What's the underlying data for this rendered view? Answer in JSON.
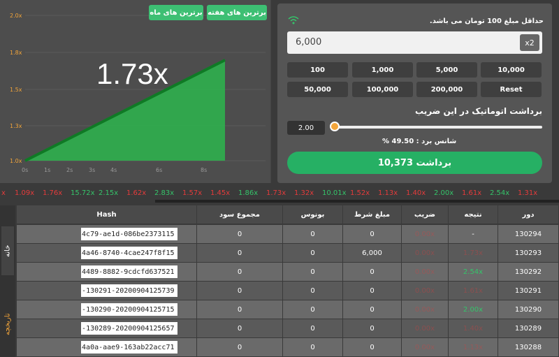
{
  "chart": {
    "multiplier": "1.73x",
    "y_ticks": [
      "2.0x",
      "1.8x",
      "1.5x",
      "1.3x",
      "1.0x"
    ],
    "x_ticks": [
      "0s",
      "1s",
      "2s",
      "3s",
      "4s",
      "6s",
      "8s"
    ],
    "best_week": "برترین های هفته",
    "best_month": "برترین های ماه"
  },
  "bet": {
    "min_note": "حداقل مبلغ 100 تومان می باشد.",
    "amount": "6,000",
    "x2_label": "x2",
    "quick_row1": [
      "10,000",
      "5,000",
      "1,000",
      "100"
    ],
    "quick_row2": [
      "Reset",
      "200,000",
      "100,000",
      "50,000"
    ],
    "auto_label": "برداشت اتوماتیک در این ضریب",
    "auto_value": "2.00",
    "chance": "شانس برد : 49.50 %",
    "cashout": "برداشت 10,373"
  },
  "ticker": [
    {
      "v": "x",
      "c": "red"
    },
    {
      "v": "1.09x",
      "c": "red"
    },
    {
      "v": "1.76x",
      "c": "red"
    },
    {
      "v": "15.72x",
      "c": "green"
    },
    {
      "v": "2.15x",
      "c": "green"
    },
    {
      "v": "1.62x",
      "c": "red"
    },
    {
      "v": "2.83x",
      "c": "green"
    },
    {
      "v": "1.57x",
      "c": "red"
    },
    {
      "v": "1.45x",
      "c": "red"
    },
    {
      "v": "1.86x",
      "c": "green"
    },
    {
      "v": "1.73x",
      "c": "red"
    },
    {
      "v": "1.32x",
      "c": "red"
    },
    {
      "v": "10.01x",
      "c": "green"
    },
    {
      "v": "1.52x",
      "c": "red"
    },
    {
      "v": "1.13x",
      "c": "red"
    },
    {
      "v": "1.40x",
      "c": "red"
    },
    {
      "v": "2.00x",
      "c": "green"
    },
    {
      "v": "1.61x",
      "c": "red"
    },
    {
      "v": "2.54x",
      "c": "green"
    },
    {
      "v": "1.31x",
      "c": "red"
    }
  ],
  "side_tabs": [
    "خانه",
    "تاریخچه"
  ],
  "table": {
    "headers": [
      "دور",
      "نتیجه",
      "ضریب",
      "مبلغ شرط",
      "بونوس",
      "مجموع سود",
      "Hash"
    ],
    "rows": [
      {
        "round": "130294",
        "result": "-",
        "rc": "",
        "mult": "0.00x",
        "bet": "0",
        "bonus": "0",
        "profit": "0",
        "hash": "-4c79-ae1d-086be2373115"
      },
      {
        "round": "130293",
        "result": "1.73x",
        "rc": "red",
        "mult": "0.00x",
        "bet": "6,000",
        "bonus": "0",
        "profit": "0",
        "hash": "-4a46-8740-4cae247f8f15"
      },
      {
        "round": "130292",
        "result": "2.54x",
        "rc": "green",
        "mult": "0.00x",
        "bet": "0",
        "bonus": "0",
        "profit": "0",
        "hash": "-4489-8882-9cdcfd637521"
      },
      {
        "round": "130291",
        "result": "1.61x",
        "rc": "red",
        "mult": "0.00x",
        "bet": "0",
        "bonus": "0",
        "profit": "0",
        "hash": "-130291-20200904125739"
      },
      {
        "round": "130290",
        "result": "2.00x",
        "rc": "green",
        "mult": "0.00x",
        "bet": "0",
        "bonus": "0",
        "profit": "0",
        "hash": "-130290-20200904125715"
      },
      {
        "round": "130289",
        "result": "1.40x",
        "rc": "red",
        "mult": "0.00x",
        "bet": "0",
        "bonus": "0",
        "profit": "0",
        "hash": "-130289-20200904125657"
      },
      {
        "round": "130288",
        "result": "1.13x",
        "rc": "red",
        "mult": "0.00x",
        "bet": "0",
        "bonus": "0",
        "profit": "0",
        "hash": "-4a0a-aae9-163ab22acc71"
      }
    ]
  },
  "colors": {
    "accent": "#26b064",
    "red": "#e53b3b",
    "green": "#35c46a",
    "orange": "#f3a53a"
  }
}
